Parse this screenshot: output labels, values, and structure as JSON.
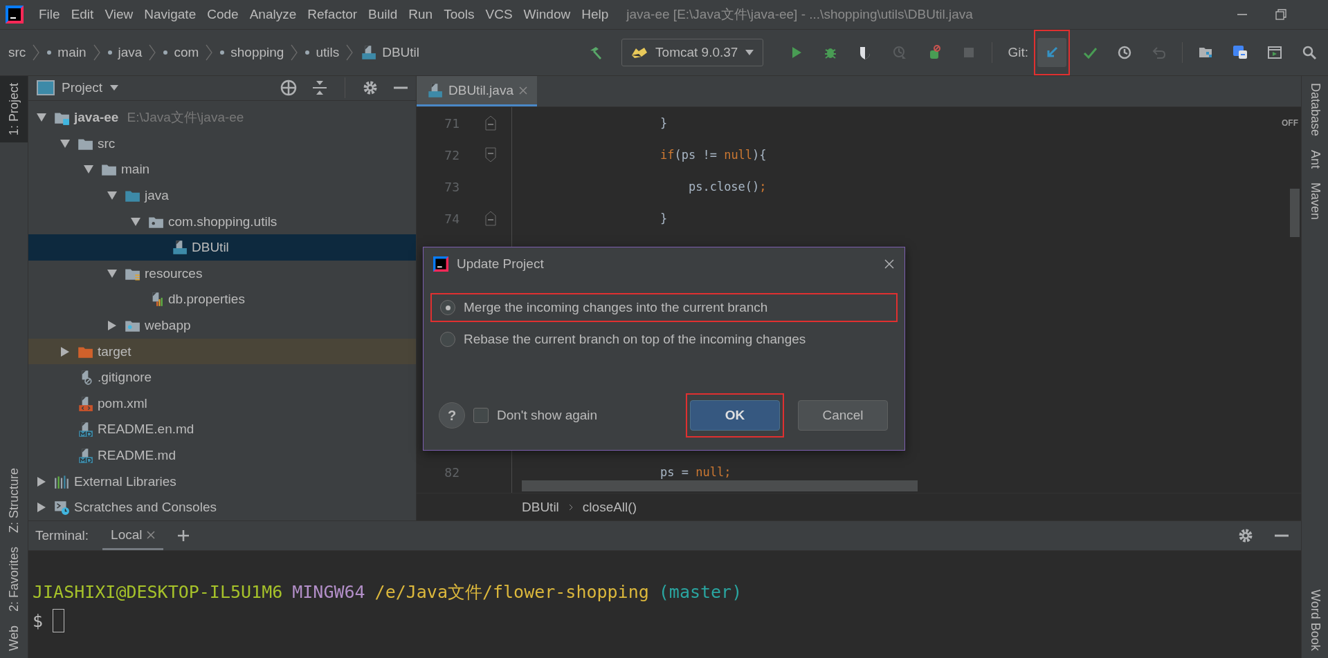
{
  "menu_bar": {
    "items": [
      "File",
      "Edit",
      "View",
      "Navigate",
      "Code",
      "Analyze",
      "Refactor",
      "Build",
      "Run",
      "Tools",
      "VCS",
      "Window",
      "Help"
    ],
    "title": "java-ee [E:\\Java文件\\java-ee] - ...\\shopping\\utils\\DBUtil.java"
  },
  "nav_path": [
    {
      "label": "src",
      "kind": "root"
    },
    {
      "label": "main",
      "kind": "package"
    },
    {
      "label": "java",
      "kind": "package"
    },
    {
      "label": "com",
      "kind": "package"
    },
    {
      "label": "shopping",
      "kind": "package"
    },
    {
      "label": "utils",
      "kind": "package"
    },
    {
      "label": "DBUtil",
      "kind": "class"
    }
  ],
  "toolbar": {
    "build": [
      {
        "kind": "build",
        "disabled": false,
        "highlighted": false
      }
    ],
    "run_config": {
      "label": "Tomcat 9.0.37"
    },
    "actions": [
      {
        "kind": "run",
        "disabled": false,
        "highlighted": false
      },
      {
        "kind": "debug",
        "disabled": false,
        "highlighted": false
      },
      {
        "kind": "coverage",
        "disabled": false,
        "highlighted": false
      },
      {
        "kind": "profile",
        "disabled": true,
        "highlighted": false
      },
      {
        "kind": "update-app",
        "disabled": false,
        "highlighted": false
      },
      {
        "kind": "stop",
        "disabled": true,
        "highlighted": false
      }
    ],
    "git_label": "Git:",
    "git_actions": [
      {
        "kind": "update",
        "disabled": false,
        "highlighted": true
      },
      {
        "kind": "commit",
        "disabled": false,
        "highlighted": false
      },
      {
        "kind": "history",
        "disabled": false,
        "highlighted": false
      },
      {
        "kind": "rollback",
        "disabled": true,
        "highlighted": false
      }
    ],
    "tools": [
      {
        "kind": "structure",
        "disabled": false,
        "highlighted": false
      },
      {
        "kind": "translate",
        "disabled": false,
        "highlighted": false
      },
      {
        "kind": "run-anything",
        "disabled": false,
        "highlighted": false
      },
      {
        "kind": "search",
        "disabled": false,
        "highlighted": false
      }
    ]
  },
  "left_tool_windows": {
    "top": [
      {
        "label": "1: Project",
        "selected": true
      }
    ],
    "bottom": [
      {
        "label": "Z: Structure",
        "selected": false
      },
      {
        "label": "2: Favorites",
        "selected": false
      },
      {
        "label": "Web",
        "selected": false
      }
    ]
  },
  "right_tool_windows": {
    "top": [
      {
        "label": "Database",
        "selected": false
      },
      {
        "label": "Ant",
        "selected": false
      },
      {
        "label": "Maven",
        "selected": false
      }
    ],
    "bottom": [
      {
        "label": "Word Book",
        "selected": false
      }
    ]
  },
  "project": {
    "title": "Project",
    "tree": [
      {
        "label": "java-ee",
        "hint": "E:\\Java文件\\java-ee",
        "kind": "module",
        "expanded": true,
        "selected": false,
        "children": [
          {
            "label": "src",
            "kind": "folder",
            "expanded": true,
            "selected": false,
            "children": [
              {
                "label": "main",
                "kind": "folder",
                "expanded": true,
                "selected": false,
                "children": [
                  {
                    "label": "java",
                    "kind": "source-folder",
                    "expanded": true,
                    "selected": false,
                    "children": [
                      {
                        "label": "com.shopping.utils",
                        "kind": "package",
                        "expanded": true,
                        "selected": false,
                        "children": [
                          {
                            "label": "DBUtil",
                            "kind": "class",
                            "selected": true
                          }
                        ]
                      }
                    ]
                  },
                  {
                    "label": "resources",
                    "kind": "resources",
                    "expanded": true,
                    "selected": false,
                    "children": [
                      {
                        "label": "db.properties",
                        "kind": "properties",
                        "selected": false
                      }
                    ]
                  },
                  {
                    "label": "webapp",
                    "kind": "web-folder",
                    "expanded": false,
                    "selected": false
                  }
                ]
              }
            ]
          },
          {
            "label": "target",
            "kind": "excluded-folder",
            "expanded": false,
            "selected": false
          },
          {
            "label": ".gitignore",
            "kind": "ignore-file",
            "selected": false
          },
          {
            "label": "pom.xml",
            "kind": "xml",
            "selected": false
          },
          {
            "label": "README.en.md",
            "kind": "markdown",
            "selected": false
          },
          {
            "label": "README.md",
            "kind": "markdown",
            "selected": false
          }
        ]
      },
      {
        "label": "External Libraries",
        "kind": "libraries",
        "expanded": false,
        "selected": false
      },
      {
        "label": "Scratches and Consoles",
        "kind": "scratches",
        "expanded": false,
        "selected": false
      }
    ]
  },
  "editor": {
    "tabs": [
      {
        "label": "DBUtil.java",
        "selected": true
      }
    ],
    "lines": [
      {
        "number": "71",
        "kind": "fold-end",
        "tokens": [
          {
            "text": "}",
            "kind": "plain"
          }
        ]
      },
      {
        "number": "72",
        "kind": "fold-start",
        "tokens": [
          {
            "text": "if",
            "kind": "keyword"
          },
          {
            "text": "(ps != ",
            "kind": "plain"
          },
          {
            "text": "null",
            "kind": "keyword"
          },
          {
            "text": "){",
            "kind": "plain"
          }
        ]
      },
      {
        "number": "73",
        "kind": "plain",
        "tokens": [
          {
            "text": "    ps.close()",
            "kind": "plain"
          },
          {
            "text": ";",
            "kind": "semicolon"
          }
        ]
      },
      {
        "number": "74",
        "kind": "fold-end",
        "tokens": [
          {
            "text": "}",
            "kind": "plain"
          }
        ]
      },
      {
        "number": "82",
        "kind": "plain",
        "tokens": [
          {
            "text": "ps = ",
            "kind": "plain"
          },
          {
            "text": "null",
            "kind": "keyword"
          },
          {
            "text": ";",
            "kind": "semicolon"
          }
        ]
      }
    ],
    "inspection": "OFF",
    "breadcrumbs": [
      "DBUtil",
      "closeAll()"
    ]
  },
  "dialog": {
    "title": "Update Project",
    "options": [
      {
        "label": "Merge the incoming changes into the current branch",
        "selected": true,
        "highlighted": true
      },
      {
        "label": "Rebase the current branch on top of the incoming changes",
        "selected": false,
        "highlighted": false
      }
    ],
    "help": "?",
    "dont_show_again": {
      "label": "Don't show again",
      "checked": false
    },
    "buttons": [
      {
        "label": "OK",
        "kind": "default",
        "highlighted": true
      },
      {
        "label": "Cancel",
        "kind": "normal",
        "highlighted": false
      }
    ]
  },
  "terminal": {
    "title": "Terminal:",
    "tabs": [
      {
        "label": "Local",
        "selected": true
      }
    ],
    "prompt": [
      {
        "text": "JIASHIXI@DESKTOP-IL5U1M6",
        "color": "#a6c22a"
      },
      {
        "text": "MINGW64",
        "color": "#b38fc9"
      },
      {
        "text": "/e/Java文件/flower-shopping",
        "color": "#dcb83c"
      },
      {
        "text": "(master)",
        "color": "#2aa5a0"
      }
    ],
    "input_prompt": "$"
  }
}
